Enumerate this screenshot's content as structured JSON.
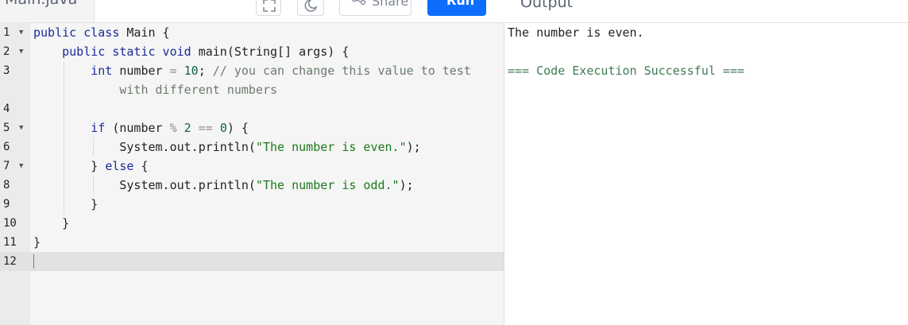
{
  "file_tab": {
    "name": "Main.java"
  },
  "toolbar": {
    "share_label": "Share",
    "run_label": "Run"
  },
  "output_panel": {
    "title": "Output",
    "lines": [
      "The number is even.",
      "",
      "=== Code Execution Successful ==="
    ]
  },
  "editor": {
    "line_numbers": [
      "1",
      "2",
      "3",
      "",
      "4",
      "5",
      "6",
      "7",
      "8",
      "9",
      "10",
      "11",
      "12"
    ],
    "code_lines": [
      "public class Main {",
      "public static void main(String[] args) {",
      "int number = 10; // you can change this value to test",
      "with different numbers",
      "",
      "if (number % 2 == 0) {",
      "System.out.println(\"The number is even.\");",
      "} else {",
      "System.out.println(\"The number is odd.\");",
      "}",
      "}",
      "}",
      ""
    ]
  },
  "colors": {
    "run_button": "#0d6efd",
    "keyword": "#1a2a9c",
    "string": "#1a7a1a",
    "success": "#3f7a55"
  }
}
